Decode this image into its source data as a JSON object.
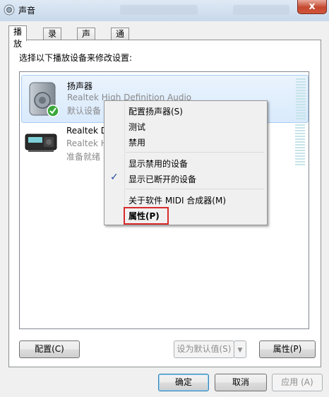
{
  "window": {
    "title": "声音",
    "close_label": "x"
  },
  "tabs": [
    {
      "label": "播放"
    },
    {
      "label": "录制"
    },
    {
      "label": "声音"
    },
    {
      "label": "通信"
    }
  ],
  "instruction": "选择以下播放设备来修改设置:",
  "devices": [
    {
      "name": "扬声器",
      "description": "Realtek High Definition Audio",
      "status": "默认设备"
    },
    {
      "name": "Realtek D",
      "description": "Realtek H",
      "status": "准备就绪"
    }
  ],
  "context_menu": {
    "items": [
      {
        "label": "配置扬声器(S)"
      },
      {
        "label": "测试"
      },
      {
        "label": "禁用"
      },
      {
        "label": "显示禁用的设备"
      },
      {
        "label": "显示已断开的设备",
        "checked": true
      },
      {
        "label": "关于软件 MIDI 合成器(M)"
      },
      {
        "label": "属性(P)",
        "highlighted": true
      }
    ]
  },
  "panel_buttons": {
    "configure": "配置(C)",
    "set_default": "设为默认值(S)",
    "properties": "属性(P)"
  },
  "dialog_buttons": {
    "ok": "确定",
    "cancel": "取消",
    "apply": "应用 (A)"
  },
  "colors": {
    "highlight_box": "#d92a2a",
    "selection": "#d9eafc"
  }
}
